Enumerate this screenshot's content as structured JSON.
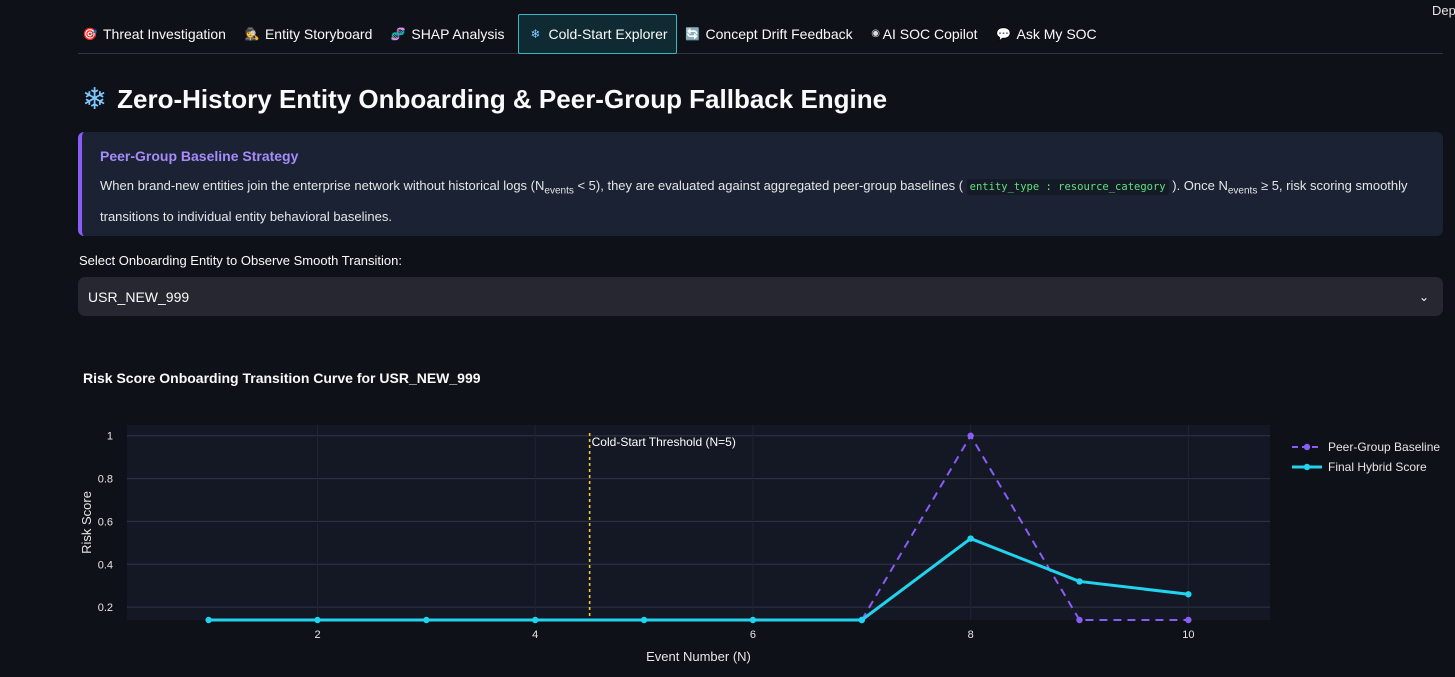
{
  "corner_text": "Dep",
  "tabs": [
    {
      "label": "Threat Investigation",
      "icon": "target-icon",
      "glyph": "🎯",
      "color": "#ff6b6b",
      "active": false
    },
    {
      "label": "Entity Storyboard",
      "icon": "detective-icon",
      "glyph": "🕵",
      "color": "#e0b070",
      "active": false
    },
    {
      "label": "SHAP Analysis",
      "icon": "dna-icon",
      "glyph": "🧬",
      "color": "#c08aff",
      "active": false
    },
    {
      "label": "Cold-Start Explorer",
      "icon": "snowflake-icon",
      "glyph": "❄",
      "color": "#7ec8ff",
      "active": true
    },
    {
      "label": "Concept Drift Feedback",
      "icon": "refresh-icon",
      "glyph": "🔄",
      "color": "#4aa3ff",
      "active": false
    },
    {
      "label": "AI SOC Copilot",
      "icon": "eye-icon",
      "glyph": "◉",
      "color": "#dddddd",
      "active": false
    },
    {
      "label": "Ask My SOC",
      "icon": "speech-bubble-icon",
      "glyph": "💬",
      "color": "#ffffff",
      "active": false
    }
  ],
  "title": "Zero-History Entity Onboarding & Peer-Group Fallback Engine",
  "callout": {
    "heading": "Peer-Group Baseline Strategy",
    "t1": "When brand-new entities join the enterprise network without historical logs (N",
    "sub1": "events",
    "t2": " < 5), they are evaluated against aggregated peer-group baselines ( ",
    "code": "entity_type : resource_category",
    "t3": " ). Once N",
    "sub2": "events",
    "t4": " ≥ 5, risk scoring smoothly transitions to individual entity behavioral baselines."
  },
  "select_label": "Select Onboarding Entity to Observe Smooth Transition:",
  "select_value": "USR_NEW_999",
  "chart_title": "Risk Score Onboarding Transition Curve for USR_NEW_999",
  "chart_data": {
    "type": "line",
    "xlabel": "Event Number (N)",
    "ylabel": "Risk Score",
    "xlim": [
      0.25,
      10.75
    ],
    "ylim": [
      0.14,
      1.05
    ],
    "xticks": [
      2,
      4,
      6,
      8,
      10
    ],
    "yticks": [
      0.2,
      0.4,
      0.6,
      0.8,
      1
    ],
    "grid": true,
    "legend_position": "top-right",
    "threshold": {
      "x": 4.5,
      "label": "Cold-Start Threshold (N=5)",
      "color": "#f5c542"
    },
    "series": [
      {
        "name": "Peer-Group Baseline",
        "color": "#8b5cf6",
        "dash": true,
        "x": [
          7,
          8,
          9,
          10
        ],
        "values": [
          0.14,
          1.0,
          0.14,
          0.14
        ]
      },
      {
        "name": "Final Hybrid Score",
        "color": "#22d3ee",
        "dash": false,
        "x": [
          1,
          2,
          3,
          4,
          5,
          6,
          7,
          8,
          9,
          10
        ],
        "values": [
          0.14,
          0.14,
          0.14,
          0.14,
          0.14,
          0.14,
          0.14,
          0.52,
          0.32,
          0.26
        ]
      }
    ]
  }
}
